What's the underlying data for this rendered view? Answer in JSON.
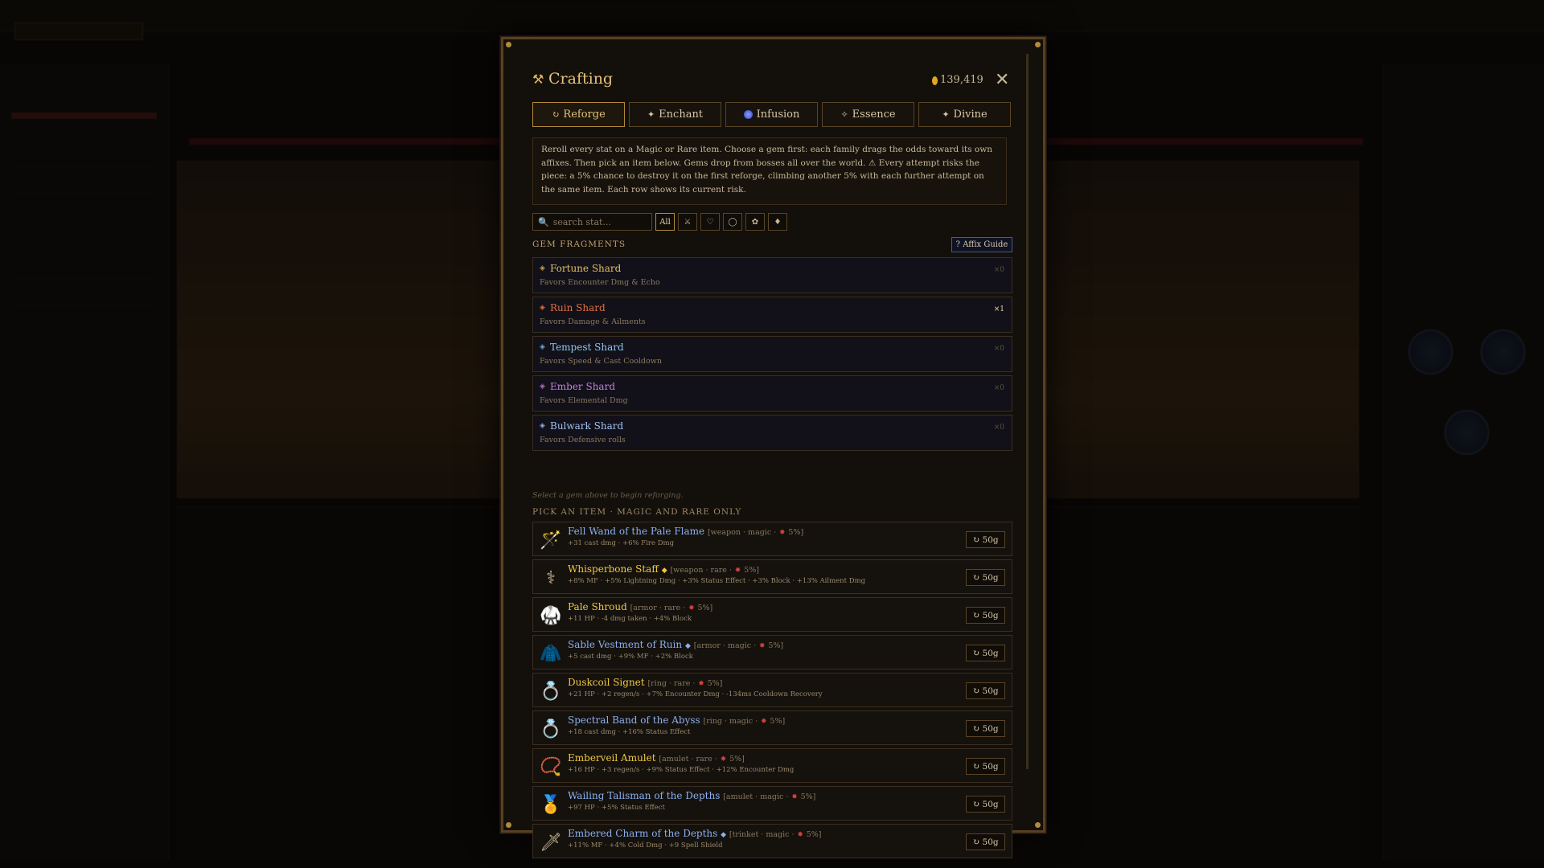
{
  "modal": {
    "title": "Crafting",
    "gold": "139,419",
    "close_symbol": "✕",
    "tabs": [
      {
        "label": "Reforge",
        "icon": "↻",
        "active": true
      },
      {
        "label": "Enchant",
        "icon": "✦",
        "active": false
      },
      {
        "label": "Infusion",
        "icon": "orb",
        "active": false
      },
      {
        "label": "Essence",
        "icon": "✧",
        "active": false
      },
      {
        "label": "Divine",
        "icon": "✦",
        "active": false
      }
    ],
    "description": "Reroll every stat on a Magic or Rare item. Choose a gem first: each family drags the odds toward its own affixes. Then pick an item below. Gems drop from bosses all over the world. ⚠ Every attempt risks the piece: a 5% chance to destroy it on the first reforge, climbing another 5% with each further attempt on the same item. Each row shows its current risk.",
    "search_placeholder": "search stat...",
    "filter_chips": [
      "All",
      "⚔",
      "♡",
      "◯",
      "✿",
      "♦"
    ],
    "gem_section_label": "GEM FRAGMENTS",
    "affix_guide_label": "? Affix Guide",
    "gems": [
      {
        "name": "Fortune Shard",
        "desc": "Favors Encounter Dmg & Echo",
        "count": "×0",
        "color": "#e0c060",
        "icon_color": "#c8a050"
      },
      {
        "name": "Ruin Shard",
        "desc": "Favors Damage & Ailments",
        "count": "×1",
        "color": "#e07040",
        "icon_color": "#e07040"
      },
      {
        "name": "Tempest Shard",
        "desc": "Favors Speed & Cast Cooldown",
        "count": "×0",
        "color": "#90c8f0",
        "icon_color": "#70a8e0"
      },
      {
        "name": "Ember Shard",
        "desc": "Favors Elemental Dmg",
        "count": "×0",
        "color": "#c080e0",
        "icon_color": "#b070d0"
      },
      {
        "name": "Bulwark Shard",
        "desc": "Favors Defensive rolls",
        "count": "×0",
        "color": "#a0c0f0",
        "icon_color": "#90b0e0"
      }
    ],
    "hint": "Select a gem above to begin reforging.",
    "item_section_label": "PICK AN ITEM · MAGIC AND RARE ONLY",
    "items": [
      {
        "name": "Fell Wand of the Pale Flame",
        "rarity_color": "blue",
        "star": false,
        "meta": "[weapon · magic ·",
        "risk": "5%]",
        "stats": "+31 cast dmg · +6% Fire Dmg",
        "cost": "↻ 50g",
        "icon": "🪄"
      },
      {
        "name": "Whisperbone Staff",
        "rarity_color": "gold",
        "star": true,
        "meta": "[weapon · rare ·",
        "risk": "5%]",
        "stats": "+8% MF · +5% Lightning Dmg · +3% Status Effect · +3% Block · +13% Ailment Dmg",
        "cost": "↻ 50g",
        "icon": "⚕"
      },
      {
        "name": "Pale Shroud",
        "rarity_color": "gold",
        "star": false,
        "meta": "[armor · rare ·",
        "risk": "5%]",
        "stats": "+11 HP · -4 dmg taken · +4% Block",
        "cost": "↻ 50g",
        "icon": "🥋"
      },
      {
        "name": "Sable Vestment of Ruin",
        "rarity_color": "blue",
        "star": true,
        "meta": "[armor · magic ·",
        "risk": "5%]",
        "stats": "+5 cast dmg · +9% MF · +2% Block",
        "cost": "↻ 50g",
        "icon": "🧥"
      },
      {
        "name": "Duskcoil Signet",
        "rarity_color": "gold",
        "star": false,
        "meta": "[ring · rare ·",
        "risk": "5%]",
        "stats": "+21 HP · +2 regen/s · +7% Encounter Dmg · -134ms Cooldown Recovery",
        "cost": "↻ 50g",
        "icon": "💍"
      },
      {
        "name": "Spectral Band of the Abyss",
        "rarity_color": "blue",
        "star": false,
        "meta": "[ring · magic ·",
        "risk": "5%]",
        "stats": "+18 cast dmg · +16% Status Effect",
        "cost": "↻ 50g",
        "icon": "💍"
      },
      {
        "name": "Emberveil Amulet",
        "rarity_color": "gold",
        "star": false,
        "meta": "[amulet · rare ·",
        "risk": "5%]",
        "stats": "+16 HP · +3 regen/s · +9% Status Effect · +12% Encounter Dmg",
        "cost": "↻ 50g",
        "icon": "📿"
      },
      {
        "name": "Wailing Talisman of the Depths",
        "rarity_color": "blue",
        "star": false,
        "meta": "[amulet · magic ·",
        "risk": "5%]",
        "stats": "+97 HP · +5% Status Effect",
        "cost": "↻ 50g",
        "icon": "🏅"
      },
      {
        "name": "Embered Charm of the Depths",
        "rarity_color": "blue",
        "star": true,
        "meta": "[trinket · magic ·",
        "risk": "5%]",
        "stats": "+11% MF · +4% Cold Dmg · +9 Spell Shield",
        "cost": "↻ 50g",
        "icon": "🗡"
      }
    ]
  }
}
